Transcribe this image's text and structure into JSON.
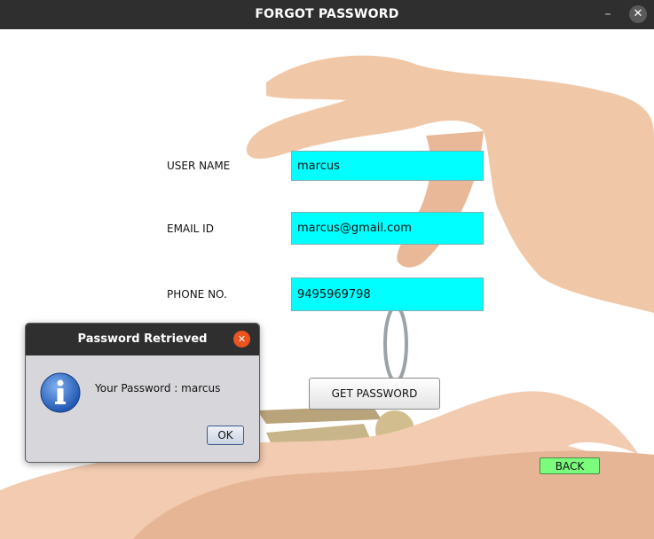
{
  "window": {
    "title": "FORGOT PASSWORD",
    "minimize_glyph": "–",
    "close_glyph": "✕"
  },
  "form": {
    "username_label": "USER NAME",
    "username_value": "marcus",
    "email_label": "EMAIL ID",
    "email_value": "marcus@gmail.com",
    "phone_label": "PHONE NO.",
    "phone_value": "9495969798",
    "get_password_label": "GET PASSWORD",
    "back_label": "BACK"
  },
  "dialog": {
    "title": "Password Retrieved",
    "close_glyph": "✕",
    "icon": "info-icon",
    "message": "Your Password : marcus",
    "ok_label": "OK"
  },
  "colors": {
    "field_bg": "#00ffff",
    "back_button": "#7cfc7c",
    "dialog_close": "#e95420",
    "titlebar": "#2f2f2f"
  }
}
